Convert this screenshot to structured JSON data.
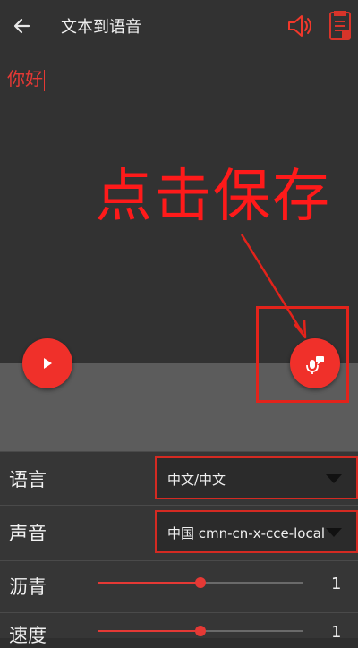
{
  "app_bar": {
    "title": "文本到语音",
    "back_icon": "arrow-left-icon",
    "speaker_icon": "speaker-icon",
    "file_icon": "file-icon",
    "accent_color": "#e53935"
  },
  "editor": {
    "text": "你好"
  },
  "annotation": {
    "text": "点击保存",
    "color": "#ff1a1a"
  },
  "actions": {
    "play_icon": "play-icon",
    "save_icon": "mic-chat-icon"
  },
  "settings": {
    "language_label": "语言",
    "language_value": "中文/中文",
    "voice_label": "声音",
    "voice_value": "中国 cmn-cn-x-cce-local",
    "pitch_label": "沥青",
    "pitch_value": "1",
    "pitch_level": 0.5,
    "speed_label": "速度",
    "speed_value": "1",
    "speed_level": 0.5
  }
}
